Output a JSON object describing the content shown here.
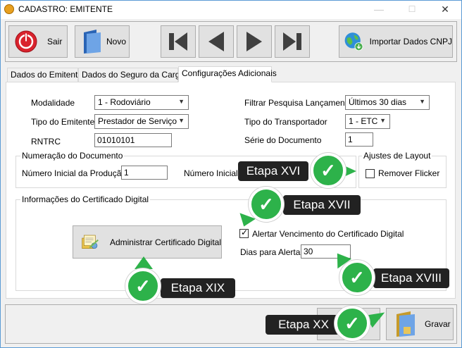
{
  "window": {
    "title": "CADASTRO: EMITENTE",
    "minimize": "—",
    "maximize": "☐",
    "close": "✕"
  },
  "toolbar": {
    "sair": "Sair",
    "novo": "Novo",
    "importar": "Importar Dados CNPJ"
  },
  "tabs": [
    {
      "label": "Dados do Emitente"
    },
    {
      "label": "Dados do Seguro da Carga"
    },
    {
      "label": "Configurações Adicionais"
    }
  ],
  "form": {
    "modalidade_label": "Modalidade",
    "modalidade_value": "1 - Rodoviário",
    "tipo_emitente_label": "Tipo do Emitente",
    "tipo_emitente_value": "Prestador de Serviço",
    "rntrc_label": "RNTRC",
    "rntrc_value": "01010101",
    "filtrar_label": "Filtrar Pesquisa Lançamento",
    "filtrar_value": "Últimos 30 dias",
    "tipo_transportador_label": "Tipo do Transportador",
    "tipo_transportador_value": "1 - ETC",
    "serie_label": "Série do Documento",
    "serie_value": "1"
  },
  "numeracao": {
    "title": "Numeração do Documento",
    "inicial_producao_label": "Número Inicial da Produção",
    "inicial_producao_value": "1",
    "inicial_h_label": "Número Inicial d"
  },
  "layout": {
    "title": "Ajustes de Layout",
    "remover_flicker": "Remover Flicker",
    "remover_flicker_checked": false
  },
  "certificado": {
    "title": "Informações do Certificado Digital",
    "admin_button": "Administrar Certificado Digital",
    "alertar_label": "Alertar Vencimento do Certificado Digital",
    "alertar_checked": true,
    "dias_label": "Dias para Alerta",
    "dias_value": "30"
  },
  "bottom": {
    "gravar": "Gravar"
  },
  "callouts": {
    "xvi": "Etapa XVI",
    "xvii": "Etapa XVII",
    "xviii": "Etapa XVIII",
    "xix": "Etapa XIX",
    "xx": "Etapa XX",
    "check": "✓"
  },
  "colors": {
    "callout_bg": "#222222",
    "callout_green": "#2db24a",
    "window_border": "#5b9bd5"
  }
}
